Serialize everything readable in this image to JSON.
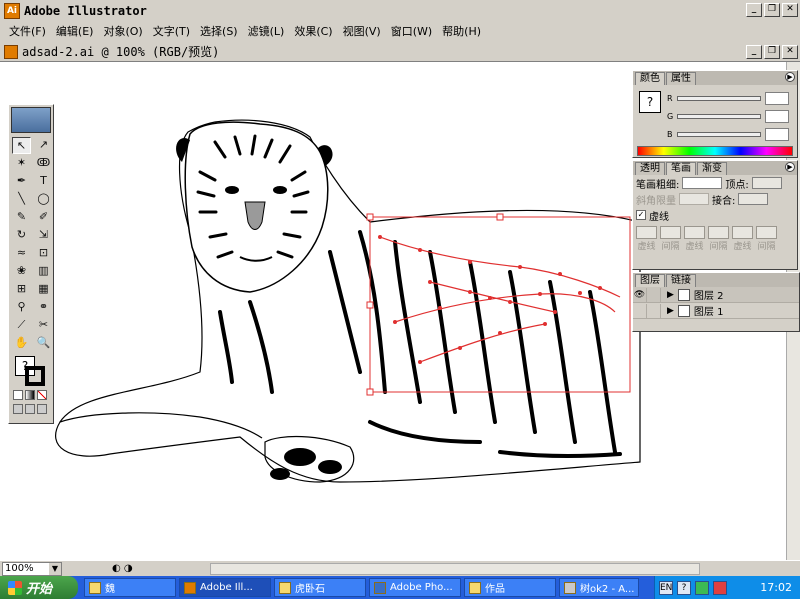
{
  "window": {
    "title": "Adobe Illustrator"
  },
  "menu": [
    "文件(F)",
    "编辑(E)",
    "对象(O)",
    "文字(T)",
    "选择(S)",
    "滤镜(L)",
    "效果(C)",
    "视图(V)",
    "窗口(W)",
    "帮助(H)"
  ],
  "document": {
    "title": "adsad-2.ai @ 100% (RGB/预览)",
    "zoom": "100%"
  },
  "color_palette": {
    "tabs": [
      "颜色",
      "属性"
    ],
    "channels": [
      "R",
      "G",
      "B"
    ]
  },
  "stroke_palette": {
    "tabs": [
      "透明",
      "笔画",
      "渐变"
    ],
    "weight_label": "笔画粗细:",
    "cap_label": "顶点:",
    "miter_label": "斜角限量",
    "join_label": "接合:",
    "dashed_label": "虚线",
    "dash_labels": [
      "虚线",
      "间隔",
      "虚线",
      "间隔",
      "虚线",
      "间隔"
    ]
  },
  "layers_palette": {
    "tabs": [
      "图层",
      "链接"
    ],
    "layers": [
      {
        "name": "图层 2",
        "visible": true,
        "selected": true
      },
      {
        "name": "图层 1",
        "visible": false,
        "selected": false
      }
    ]
  },
  "taskbar": {
    "start_label": "开始",
    "tasks": [
      "魏",
      "Adobe Ill...",
      "虎卧石",
      "Adobe Pho...",
      "作品",
      "树ok2 - A..."
    ],
    "active_task_index": 1,
    "ime": "EN",
    "help": "?",
    "clock": "17:02"
  },
  "colors": {
    "selection_red": "#e03030",
    "taskbar_blue": "#245edb",
    "start_green": "#3a8f3a"
  }
}
